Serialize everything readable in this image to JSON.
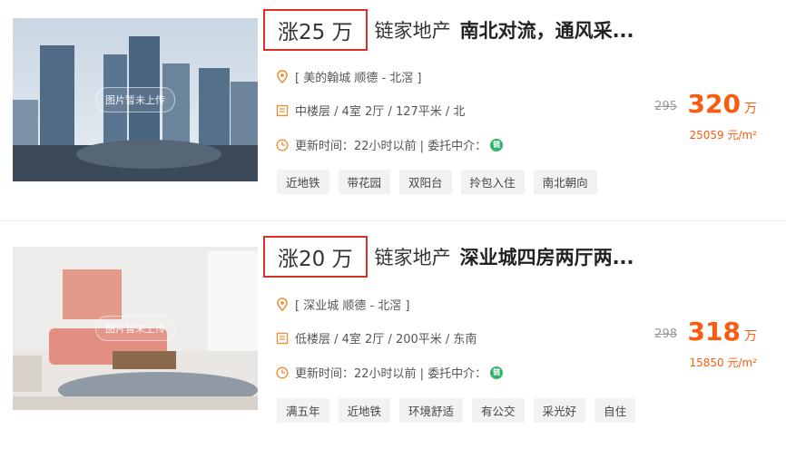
{
  "colors": {
    "accent": "#fa5b0f",
    "rise_border": "#d9302a",
    "agent_green": "#2fb36e"
  },
  "listings": [
    {
      "rise_label": "涨25 万",
      "agency": "链家地产",
      "title": "南北对流，通风采...",
      "image_placeholder": "图片暂未上传",
      "location": "[ 美的翰城 顺德 - 北滘 ]",
      "details": "中楼层 / 4室 2厅 / 127平米 / 北",
      "updated": "更新时间：22小时以前 | 委托中介：",
      "agent_badge": "链",
      "tags": [
        "近地铁",
        "带花园",
        "双阳台",
        "拎包入住",
        "南北朝向"
      ],
      "old_price": "295",
      "price": "320",
      "price_unit": "万",
      "unit_price": "25059 元/m²"
    },
    {
      "rise_label": "涨20 万",
      "agency": "链家地产",
      "title": "深业城四房两厅两...",
      "image_placeholder": "图片暂未上传",
      "location": "[ 深业城 顺德 - 北滘 ]",
      "details": "低楼层 / 4室 2厅 / 200平米 / 东南",
      "updated": "更新时间：22小时以前 | 委托中介：",
      "agent_badge": "链",
      "tags": [
        "满五年",
        "近地铁",
        "环境舒适",
        "有公交",
        "采光好",
        "自住"
      ],
      "old_price": "298",
      "price": "318",
      "price_unit": "万",
      "unit_price": "15850 元/m²"
    }
  ]
}
